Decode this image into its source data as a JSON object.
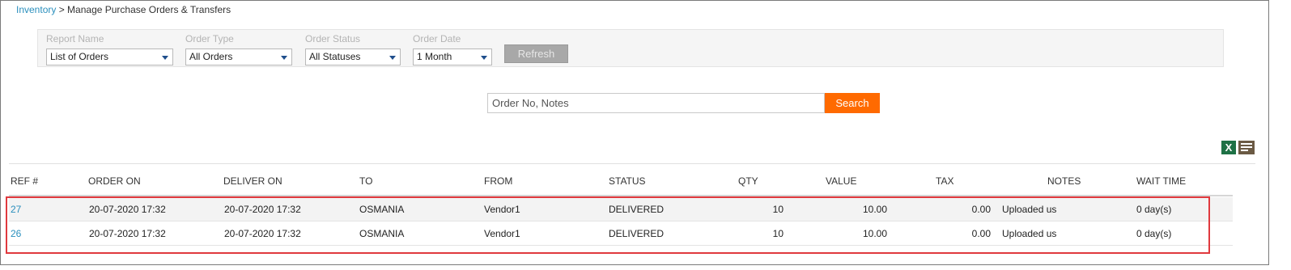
{
  "breadcrumb": {
    "root": "Inventory",
    "separator": " > ",
    "current": "Manage Purchase Orders & Transfers"
  },
  "filters": {
    "report_name": {
      "label": "Report Name",
      "value": "List of Orders"
    },
    "order_type": {
      "label": "Order Type",
      "value": "All Orders"
    },
    "order_status": {
      "label": "Order Status",
      "value": "All Statuses"
    },
    "order_date": {
      "label": "Order Date",
      "value": "1 Month"
    },
    "refresh_label": "Refresh"
  },
  "search": {
    "placeholder": "Order No, Notes",
    "button_label": "Search"
  },
  "toolbar": {
    "excel_icon_letter": "X",
    "excel_color": "#1e7145",
    "list_icon_color": "#6b5a44"
  },
  "accent": {
    "link": "#2a8fbd",
    "search": "#ff6a00",
    "highlight": "#e0393e"
  },
  "table": {
    "columns": [
      "REF #",
      "ORDER ON",
      "DELIVER ON",
      "TO",
      "FROM",
      "STATUS",
      "QTY",
      "VALUE",
      "TAX",
      "NOTES",
      "WAIT TIME"
    ],
    "rows": [
      {
        "ref": "27",
        "order_on": "20-07-2020 17:32",
        "deliver_on": "20-07-2020 17:32",
        "to": "OSMANIA",
        "from": "Vendor1",
        "status": "DELIVERED",
        "qty": "10",
        "value": "10.00",
        "tax": "0.00",
        "notes": "Uploaded us",
        "wait_time": "0 day(s)"
      },
      {
        "ref": "26",
        "order_on": "20-07-2020 17:32",
        "deliver_on": "20-07-2020 17:32",
        "to": "OSMANIA",
        "from": "Vendor1",
        "status": "DELIVERED",
        "qty": "10",
        "value": "10.00",
        "tax": "0.00",
        "notes": "Uploaded us",
        "wait_time": "0 day(s)"
      }
    ]
  }
}
